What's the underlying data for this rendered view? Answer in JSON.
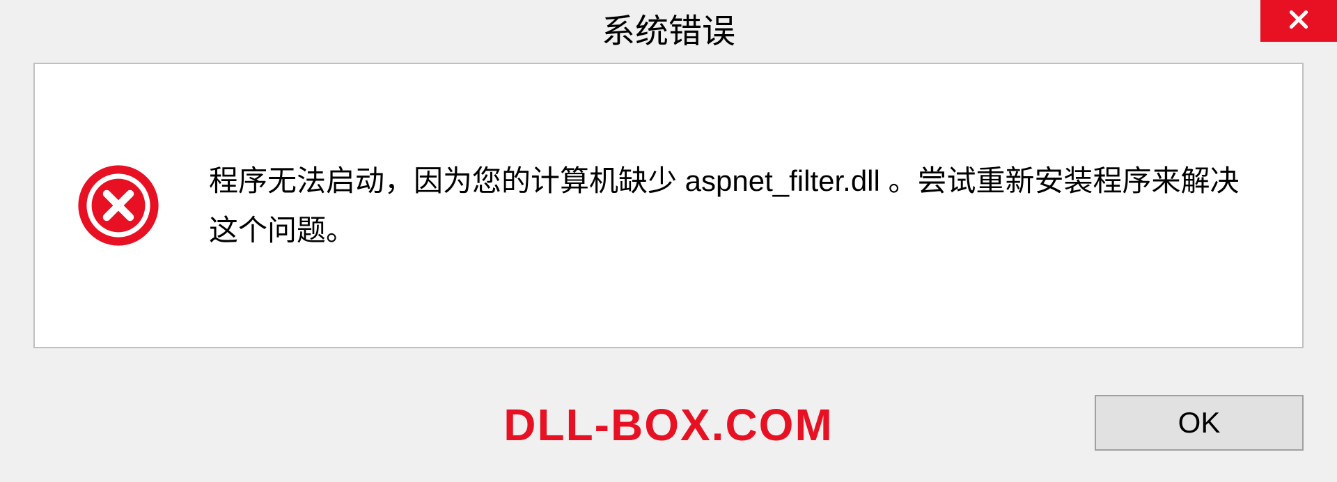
{
  "titlebar": {
    "title": "系统错误"
  },
  "dialog": {
    "message": "程序无法启动，因为您的计算机缺少 aspnet_filter.dll 。尝试重新安装程序来解决这个问题。"
  },
  "footer": {
    "watermark": "DLL-BOX.COM",
    "ok_label": "OK"
  },
  "colors": {
    "error_red": "#e81123",
    "bg": "#f0f0f0"
  }
}
